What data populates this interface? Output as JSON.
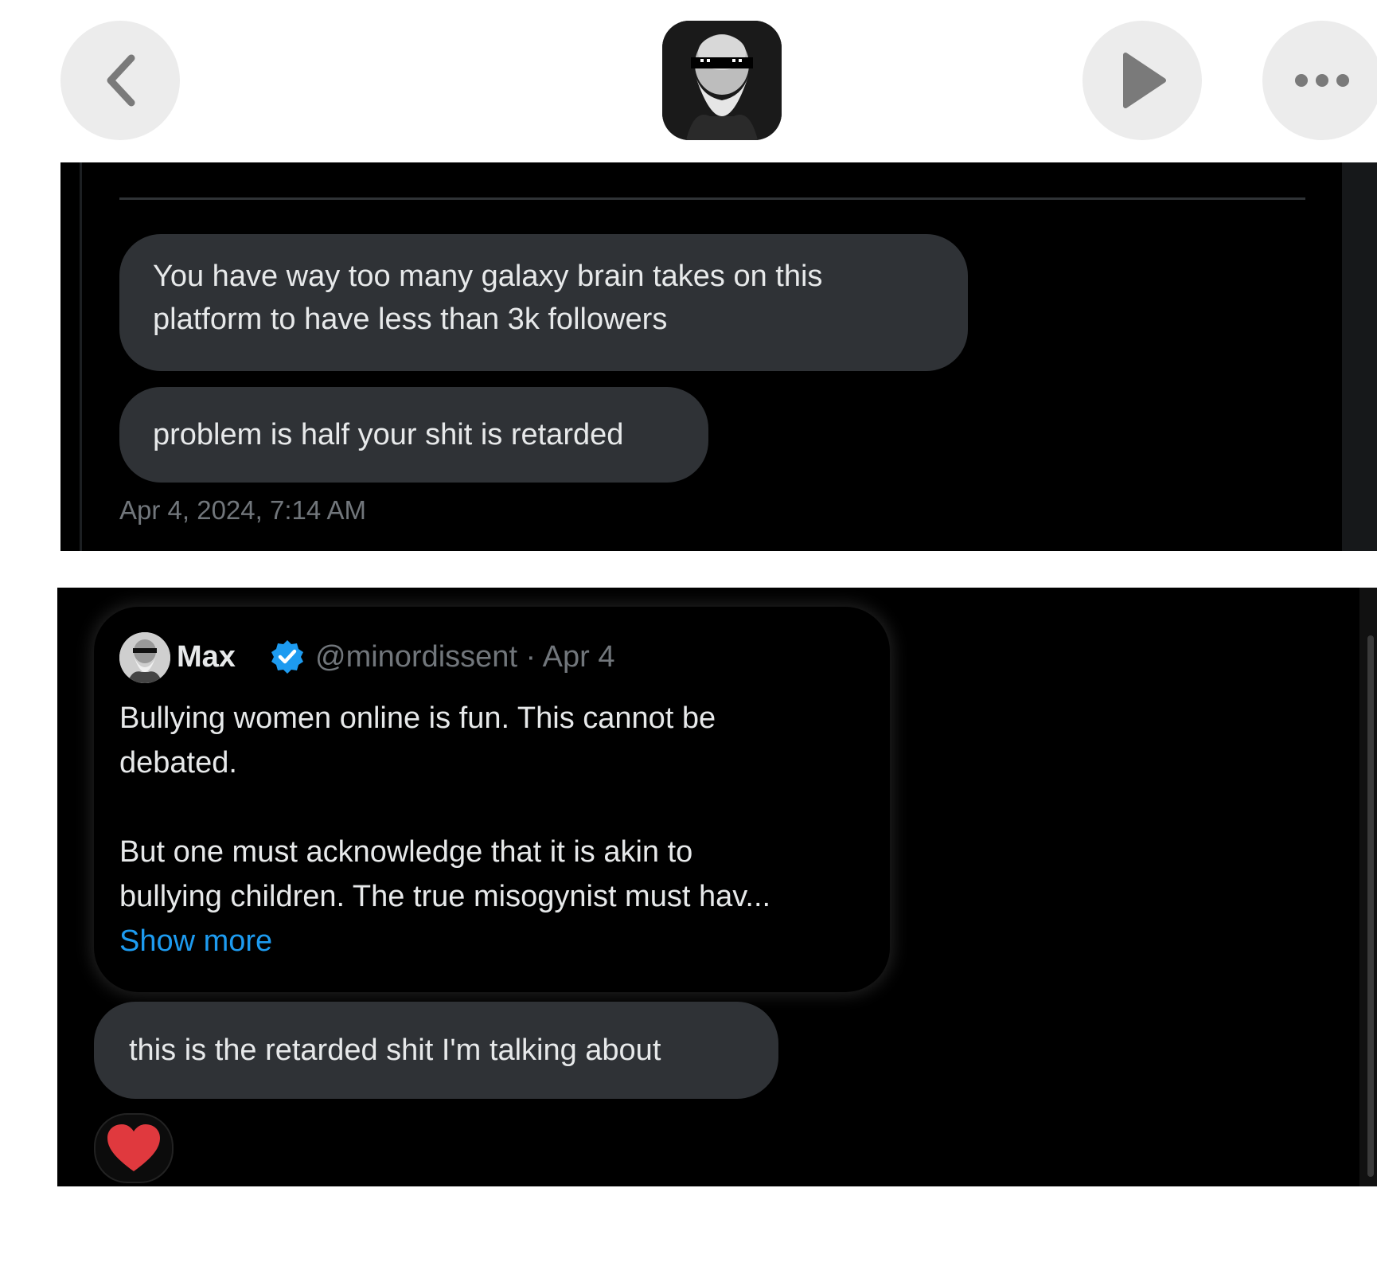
{
  "top_bar": {
    "back_icon": "chevron-left-icon",
    "play_icon": "play-icon",
    "more_icon": "ellipsis-icon"
  },
  "dm_top": {
    "messages": [
      {
        "text": "You have way too many galaxy brain takes on this\nplatform to have less than 3k followers"
      },
      {
        "text": "problem is half your shit is retarded"
      }
    ],
    "timestamp": "Apr 4, 2024, 7:14 AM"
  },
  "dm_bottom": {
    "quote": {
      "name": "Max",
      "handle_date": "@minordissent · Apr 4",
      "paragraph_1": "Bullying women online is fun. This cannot be\ndebated.",
      "paragraph_2": "But one must acknowledge that it is akin to\nbullying children. The true misogynist must hav...",
      "show_more": "Show more"
    },
    "reply": "this is the retarded shit I'm talking about",
    "reaction_icon": "heart-icon"
  },
  "colors": {
    "panel_bg": "#000000",
    "bubble_bg": "#2f3236",
    "text": "#e7e9ea",
    "muted": "#71767b",
    "link": "#1d9bf0",
    "verified": "#1d9bf0",
    "heart": "#f91880"
  }
}
